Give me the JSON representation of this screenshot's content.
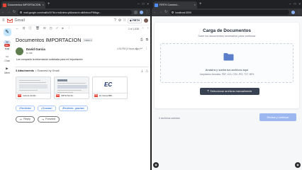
{
  "left_window": {
    "tab": {
      "title": "Documentos IMPORTACION",
      "favicon_color": "#ea4335"
    },
    "url": "mail.google.com/mail/u/0/?ik=rrm&view=pt&search=all#inbox/FMfcgz..."
  },
  "gmail": {
    "app_name": "Gmail",
    "brand_chip": "FIRTH",
    "pager": "2 of 1,838",
    "rail": [
      {
        "icon": "mail-icon",
        "label": "Mail",
        "badge": "99+"
      },
      {
        "icon": "chat-icon",
        "label": "Chat"
      },
      {
        "icon": "meet-icon",
        "label": "Meet"
      }
    ],
    "subject": "Documentos IMPORTACION",
    "label_chip": "Inbox ×",
    "sender": {
      "name": "David Garcia",
      "to": "to me",
      "date": "4:02 PM (3 hours ago)"
    },
    "body": "Les comparto la información solicitada para mi importación",
    "attachments_header": {
      "count": "3 Attachments",
      "scanned": "• Scanned by Gmail"
    },
    "attachments": [
      {
        "name": "Factura Juridic..."
      },
      {
        "name": "FIRTH SA 44..."
      },
      {
        "name": "EC Group BRI..."
      }
    ],
    "ec_logo": "EC",
    "smart_replies": [
      "¡Recibido!",
      "¡Gracias!",
      "¡Recibido, gracias!"
    ],
    "reply_label": "Reply",
    "forward_label": "Forward"
  },
  "right_window": {
    "tab": {
      "title": "FIRTH Comerci...",
      "favicon_color": "#4f8ef7"
    },
    "url": "localhost:3000"
  },
  "upload": {
    "title": "Carga de Documentos",
    "subtitle": "Sube los documentos necesarios para continuar",
    "dropzone_text": "Arrastra y suelta tus archivos aquí",
    "formats": "Aceptamos formatos: PDF, XLS, CSV, JPG, TXT, MP4",
    "select_button": "Seleccionar archivos manualmente",
    "count_text": "0 archivos subidos",
    "continue_button": "Revisar y continuar",
    "accent": "#374151",
    "continue_color": "#9db8f0"
  }
}
